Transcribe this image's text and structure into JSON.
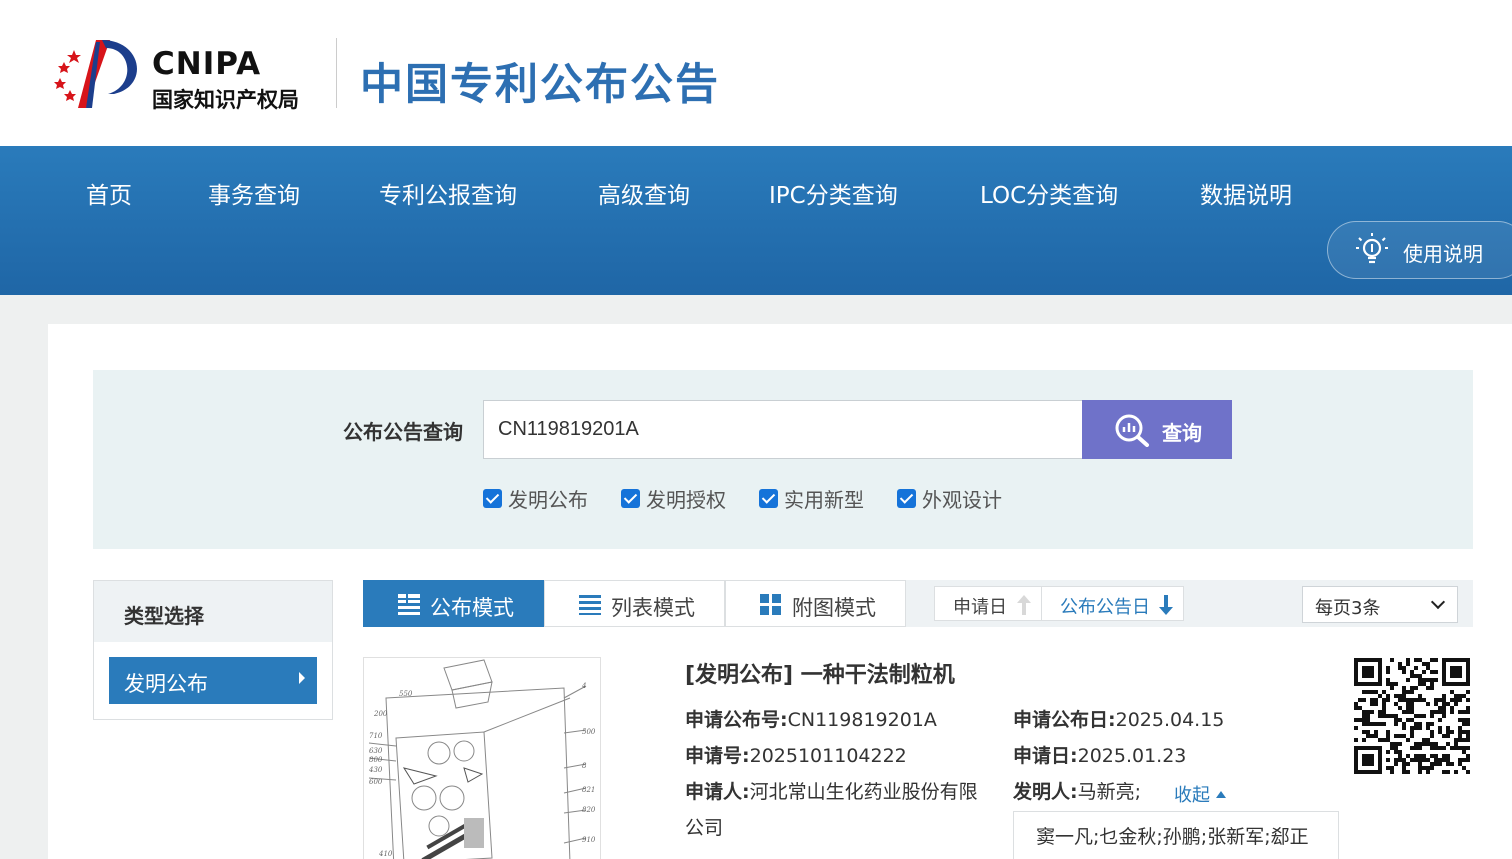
{
  "header": {
    "logo_en": "CNIPA",
    "logo_cn": "国家知识产权局",
    "site_title": "中国专利公布公告"
  },
  "nav": {
    "items": [
      {
        "label": "首页"
      },
      {
        "label": "事务查询"
      },
      {
        "label": "专利公报查询"
      },
      {
        "label": "高级查询"
      },
      {
        "label": "IPC分类查询"
      },
      {
        "label": "LOC分类查询"
      },
      {
        "label": "数据说明"
      }
    ],
    "help_label": "使用说明"
  },
  "search": {
    "label": "公布公告查询",
    "value": "CN119819201A",
    "button_label": "查询",
    "checkboxes": [
      {
        "label": "发明公布",
        "checked": true
      },
      {
        "label": "发明授权",
        "checked": true
      },
      {
        "label": "实用新型",
        "checked": true
      },
      {
        "label": "外观设计",
        "checked": true
      }
    ]
  },
  "type_filter": {
    "title": "类型选择",
    "selected": "发明公布"
  },
  "toolbar": {
    "modes": [
      {
        "label": "公布模式",
        "active": true
      },
      {
        "label": "列表模式",
        "active": false
      },
      {
        "label": "附图模式",
        "active": false
      }
    ],
    "sort_apply_date": "申请日",
    "sort_pub_date": "公布公告日",
    "per_page": "每页3条"
  },
  "result": {
    "title": "[发明公布] 一种干法制粒机",
    "pub_no_label": "申请公布号:",
    "pub_no": "CN119819201A",
    "pub_date_label": "申请公布日:",
    "pub_date": "2025.04.15",
    "app_no_label": "申请号:",
    "app_no": "2025101104222",
    "app_date_label": "申请日:",
    "app_date": "2025.01.23",
    "applicant_label": "申请人:",
    "applicant_line1": "河北常山生化药业股份有限",
    "applicant_line2": "公司",
    "inventor_label": "发明人:",
    "inventor": "马新亮;",
    "collapse_label": "收起",
    "more_inventors": "窦一凡;乜金秋;孙鹏;张新军;郄正"
  }
}
